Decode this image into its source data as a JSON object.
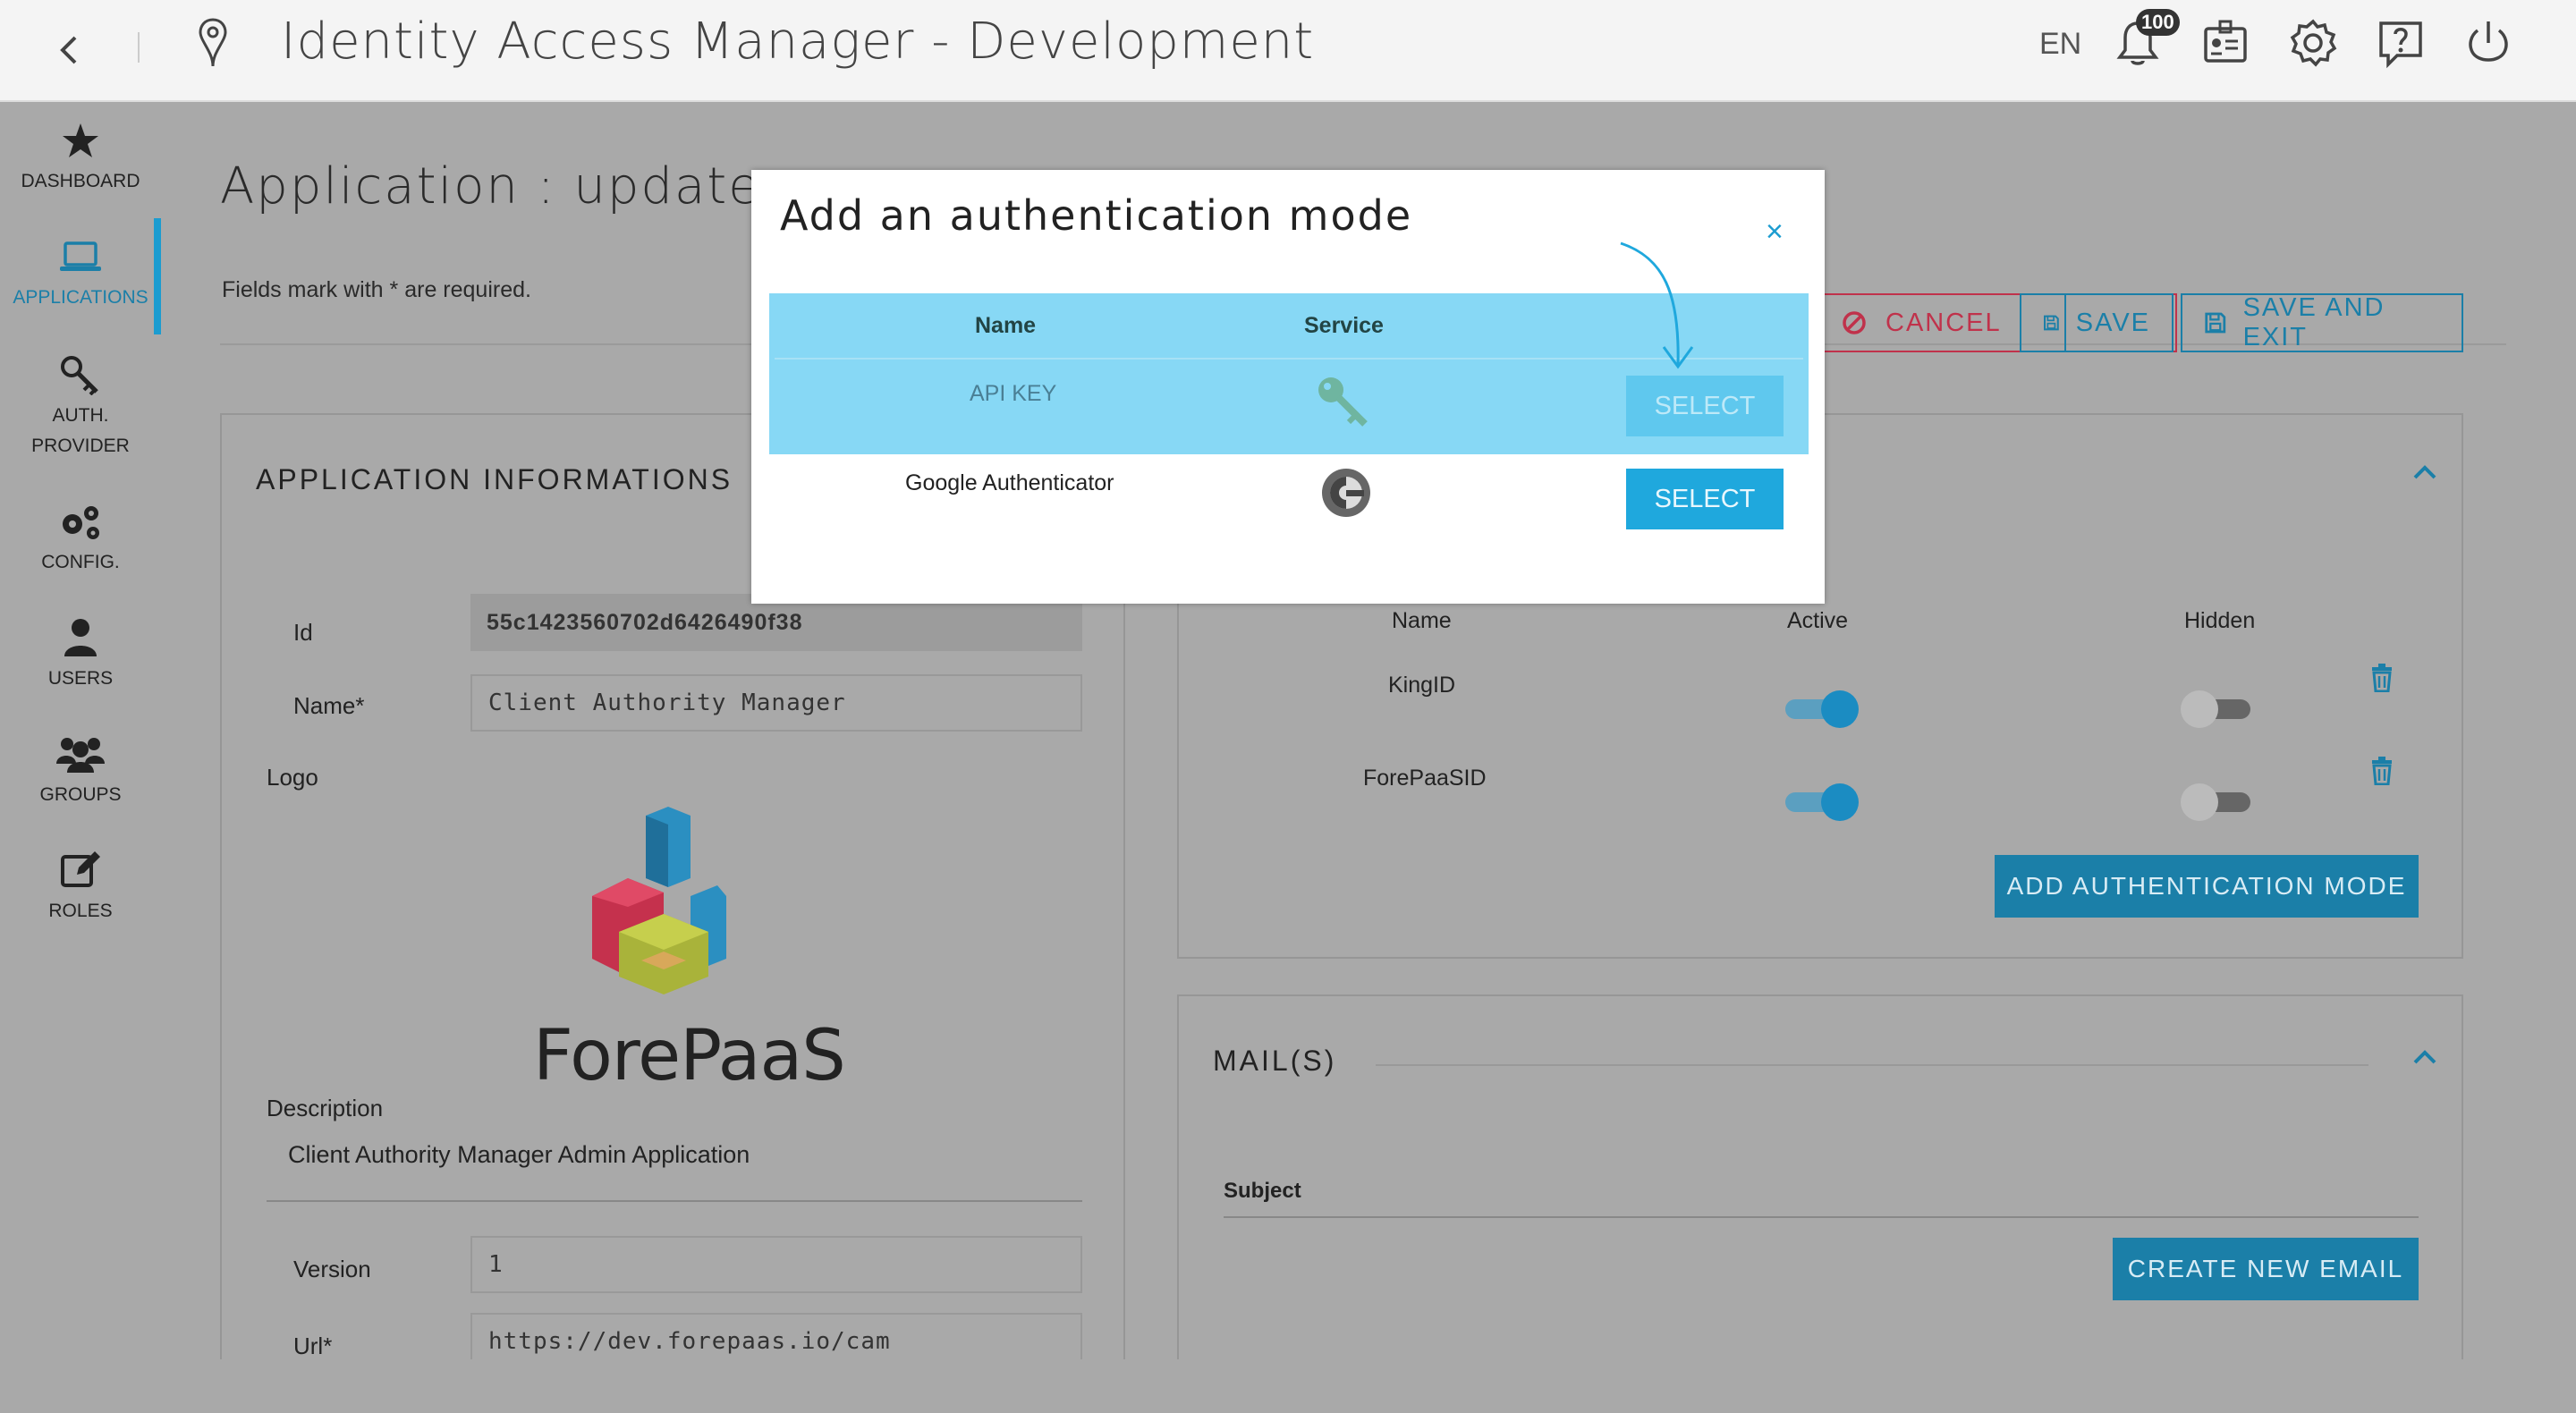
{
  "topbar": {
    "title": "Identity Access Manager - Development",
    "lang": "EN",
    "notifications_count": "100"
  },
  "sidebar": {
    "items": [
      {
        "label": "DASHBOARD",
        "icon": "star-icon"
      },
      {
        "label": "APPLICATIONS",
        "icon": "laptop-icon",
        "active": true
      },
      {
        "label": "AUTH.",
        "label2": "PROVIDER",
        "icon": "key-icon"
      },
      {
        "label": "CONFIG.",
        "icon": "gears-icon"
      },
      {
        "label": "USERS",
        "icon": "user-icon"
      },
      {
        "label": "GROUPS",
        "icon": "group-icon"
      },
      {
        "label": "ROLES",
        "icon": "edit-icon"
      }
    ]
  },
  "page": {
    "title": "Application : update",
    "required_note": "Fields mark with * are required.",
    "cancel_label": "CANCEL",
    "save_label": "SAVE",
    "save_exit_label": "SAVE AND EXIT"
  },
  "app_info": {
    "section_title": "APPLICATION INFORMATIONS",
    "id_label": "Id",
    "id_value": "55c1423560702d6426490f38",
    "name_label": "Name*",
    "name_value": "Client Authority Manager",
    "logo_label": "Logo",
    "logo_text": "ForePaaS",
    "description_label": "Description",
    "description_value": "Client Authority Manager Admin Application",
    "version_label": "Version",
    "version_value": "1",
    "url_label": "Url*",
    "url_value": "https://dev.forepaas.io/cam"
  },
  "auth_modes": {
    "col_name": "Name",
    "col_active": "Active",
    "col_hidden": "Hidden",
    "rows": [
      {
        "name": "KingID",
        "active": true,
        "hidden": false
      },
      {
        "name": "ForePaaSID",
        "active": true,
        "hidden": false
      }
    ],
    "add_button": "ADD AUTHENTICATION MODE"
  },
  "mails": {
    "section_title": "MAIL(S)",
    "subject_header": "Subject",
    "create_button": "CREATE NEW EMAIL"
  },
  "modal": {
    "title": "Add an authentication mode",
    "close": "×",
    "col_name": "Name",
    "col_service": "Service",
    "rows": [
      {
        "name": "API KEY",
        "service_icon": "key-icon",
        "button": "SELECT",
        "highlighted": true
      },
      {
        "name": "Google Authenticator",
        "service_icon": "google-authenticator-icon",
        "button": "SELECT",
        "highlighted": false
      }
    ]
  },
  "colors": {
    "accent": "#1b7fa8",
    "modal_button": "#1fa8dd",
    "highlight": "#87d8f5",
    "cancel": "#c0324b"
  }
}
